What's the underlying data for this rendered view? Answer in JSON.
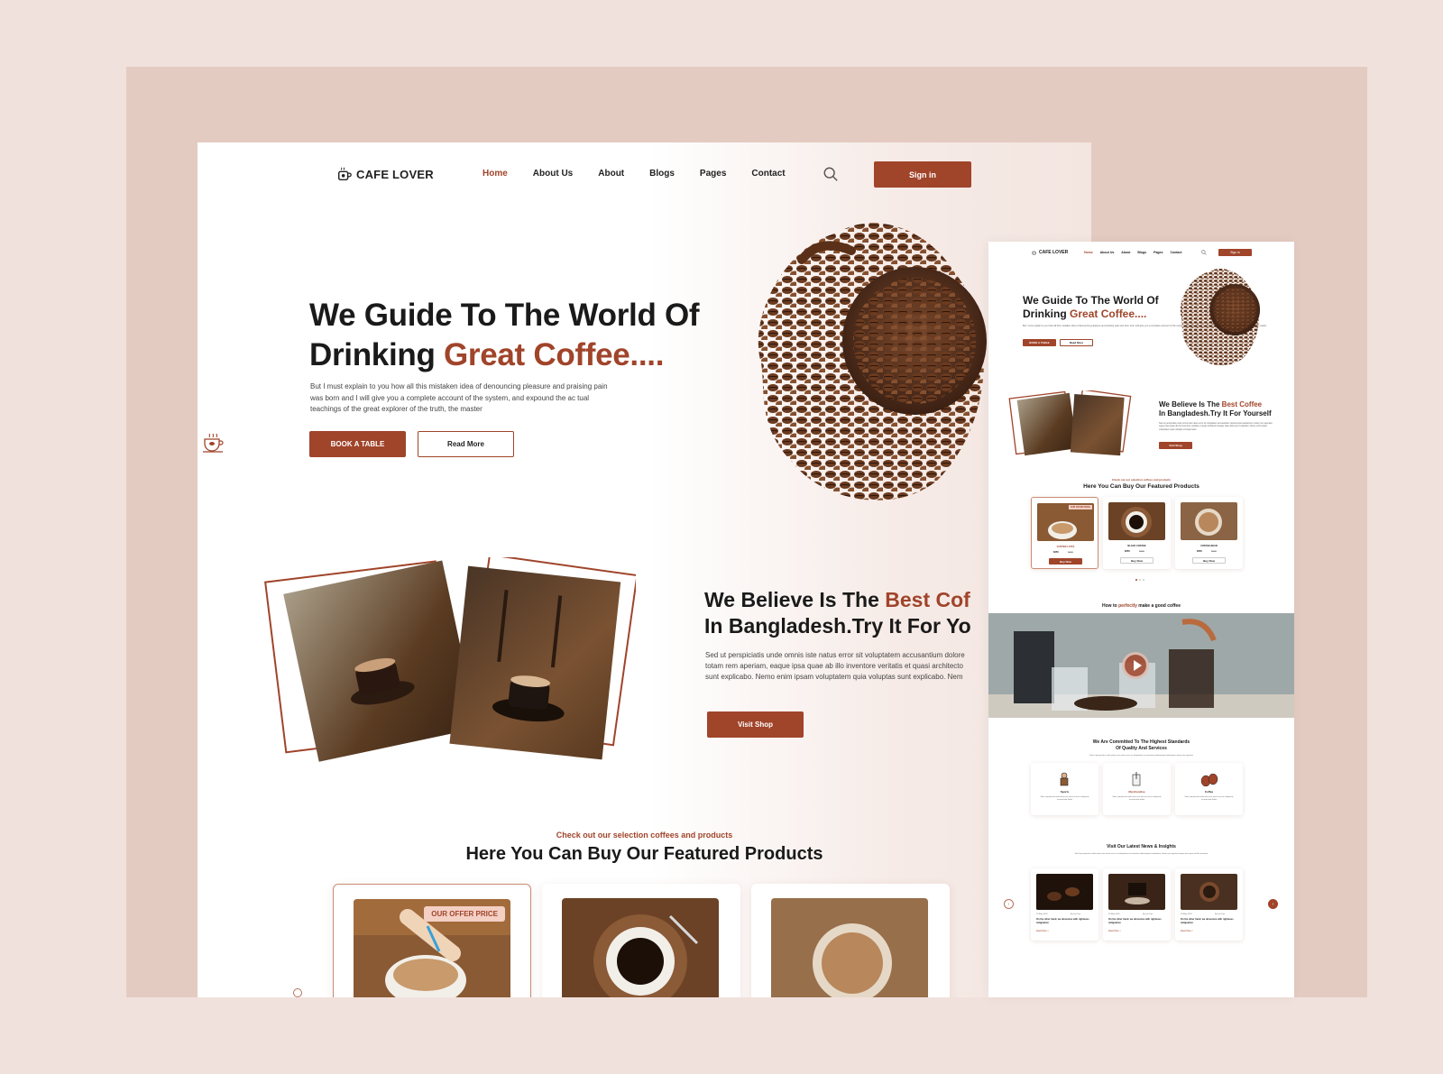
{
  "main": {
    "brand": "CAFE LOVER",
    "nav": [
      "Home",
      "About Us",
      "About",
      "Blogs",
      "Pages",
      "Contact"
    ],
    "signin": "Sign in",
    "hero": {
      "title_line1": "We Guide To The World Of",
      "title_line2_prefix": "Drinking ",
      "title_line2_accent": "Great Coffee....",
      "desc": "But I must explain to you how all this mistaken idea of denouncing pleasure and praising pain was born and I will give you a complete account of the system, and expound the ac tual teachings of the great explorer of the truth, the master",
      "book_btn": "BOOK A TABLE",
      "read_btn": "Read More"
    },
    "believe": {
      "line1_prefix": "We Believe Is The ",
      "line1_accent": "Best Cof",
      "line2": "In Bangladesh.Try It For Yo",
      "desc_line1": "Sed ut perspiciatis unde omnis iste natus error sit voluptatem accusantium dolore",
      "desc_line2": "totam rem aperiam, eaque ipsa quae ab illo inventore veritatis et quasi architecto",
      "desc_line3": "sunt explicabo. Nemo enim ipsam voluptatem quia voluptas  sunt explicabo. Nem",
      "shop_btn": "Visit Shop"
    },
    "featured": {
      "subtitle": "Check out our selection coffees and products",
      "title": "Here You Can Buy Our Featured Products",
      "offer_tag": "OUR OFFER PRICE"
    }
  },
  "mini": {
    "brand": "CAFE LOVER",
    "nav": [
      "Home",
      "About Us",
      "About",
      "Blogs",
      "Pages",
      "Contact"
    ],
    "signin": "Sign in",
    "hero_line1": "We Guide To The World Of",
    "hero_line2_prefix": "Drinking ",
    "hero_line2_accent": "Great Coffee....",
    "hero_desc": "But I must explain to you how all this mistaken idea of denouncing pleasure and praising pain was born and I will give you a complete account of the system, and expound the ac tual teachings of the great explorer of the truth, the master",
    "book_btn": "BOOK A TABLE",
    "read_btn": "Read More",
    "believe_prefix": "We Believe Is The ",
    "believe_accent": "Best Coffee",
    "believe_line2": "In Bangladesh.Try It For Yourself",
    "believe_desc": "Sed ut perspiciatis unde omnis iste natus error sit voluptatem accusantium doloremque laudantium, totam rem aperiam, eaque ipsa quae ab illo inventore veritatis et quasi architecto beatae vitae dicta sunt explicabo. Nemo enim ipsam voluptatem quia voluptas sit aspernatur.",
    "shop_btn": "Visit Shop",
    "feat_sub": "Check out our selection coffees and products",
    "feat_title": "Here You Can Buy Our Featured Products",
    "products": [
      {
        "name": "CUPPER LATTE",
        "price": "$250",
        "old": "$300",
        "btn": "Buy Now"
      },
      {
        "name": "BLACK COFFEE",
        "price": "$250",
        "old": "$300",
        "btn": "Buy Now"
      },
      {
        "name": "COFFEE BEAN",
        "price": "$250",
        "old": "$300",
        "btn": "Buy Now"
      }
    ],
    "offer_tag": "OUR OFFER PRICE",
    "howto_prefix": "How to ",
    "howto_accent": "perfectly",
    "howto_suffix": " make a good coffee",
    "commit_line1": "We Are Committed To The Highest Standards",
    "commit_line2": "Of Quality And Services",
    "commit_desc": "Sed ut perspiciatis unde omnis iste natus error sit voluptatem accusantium doloremque laudantium, totam rem aperiam",
    "services": [
      {
        "name": "Sports",
        "desc": "Sed ut perspiciatis unde omnis iste natus error sit voluptatem accusantium dolore"
      },
      {
        "name": "Merchandise",
        "desc": "Sed ut perspiciatis unde omnis iste natus error sit voluptatem accusantium dolore"
      },
      {
        "name": "Coffee",
        "desc": "Sed ut perspiciatis unde omnis iste natus error sit voluptatem accusantium dolore"
      }
    ],
    "news_title": "Visit Our Latest News & Insights",
    "news_desc": "Sed ut perspiciatis unde omnis iste natus error sit voluptatem accusantium doloremque laudantium, totam rem aperiam eaque ipsa quae ab illo inventore",
    "news": [
      {
        "date": "20 May 2022",
        "by": "By Jan Doe",
        "text": "On the other hand, we denounce with righteous indignation",
        "more": "Read More >"
      },
      {
        "date": "20 May 2022",
        "by": "By Jan Doe",
        "text": "On the other hand, we denounce with righteous indignation",
        "more": "Read More >"
      },
      {
        "date": "20 May 2022",
        "by": "By Jan Doe",
        "text": "On the other hand, we denounce with righteous indignation",
        "more": "Read More >"
      }
    ]
  },
  "colors": {
    "accent": "#a0442a",
    "background": "#f1e1dd",
    "frame": "#e4cbc1"
  },
  "icons": [
    "coffee-cup-icon",
    "search-icon",
    "play-icon",
    "barista-icon",
    "coffee-press-icon",
    "coffee-beans-icon",
    "arrow-left-icon",
    "arrow-right-icon"
  ]
}
